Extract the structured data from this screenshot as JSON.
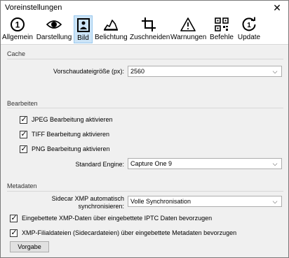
{
  "window": {
    "title": "Voreinstellungen",
    "close": "✕"
  },
  "toolbar": {
    "items": [
      {
        "label": "Allgemein"
      },
      {
        "label": "Darstellung"
      },
      {
        "label": "Bild"
      },
      {
        "label": "Belichtung"
      },
      {
        "label": "Zuschneiden"
      },
      {
        "label": "Warnungen"
      },
      {
        "label": "Befehle"
      },
      {
        "label": "Update"
      }
    ],
    "selected": "Bild",
    "badge_1": "1"
  },
  "cache": {
    "title": "Cache",
    "preview_label": "Vorschaudateigröße (px):",
    "preview_value": "2560"
  },
  "bearbeiten": {
    "title": "Bearbeiten",
    "jpeg": {
      "label": "JPEG Bearbeitung aktivieren",
      "checked": true
    },
    "tiff": {
      "label": "TIFF Bearbeitung aktivieren",
      "checked": true
    },
    "png": {
      "label": "PNG Bearbeitung aktivieren",
      "checked": true
    },
    "engine_label": "Standard Engine:",
    "engine_value": "Capture One 9"
  },
  "metadaten": {
    "title": "Metadaten",
    "sidecar_label_1": "Sidecar XMP automatisch",
    "sidecar_label_2": "synchronisieren:",
    "sidecar_value": "Volle Synchronisation",
    "xmp_iptc": {
      "label": "Eingebettete XMP-Daten über eingebettete IPTC Daten bevorzugen",
      "checked": true
    },
    "xmp_sidecar": {
      "label": "XMP-Filialdateien (Sidecardateien) über eingebettete Metadaten bevorzugen",
      "checked": true
    }
  },
  "footer": {
    "defaults_button": "Vorgabe"
  },
  "glyphs": {
    "check": "✓",
    "dropdown": "⌵"
  }
}
